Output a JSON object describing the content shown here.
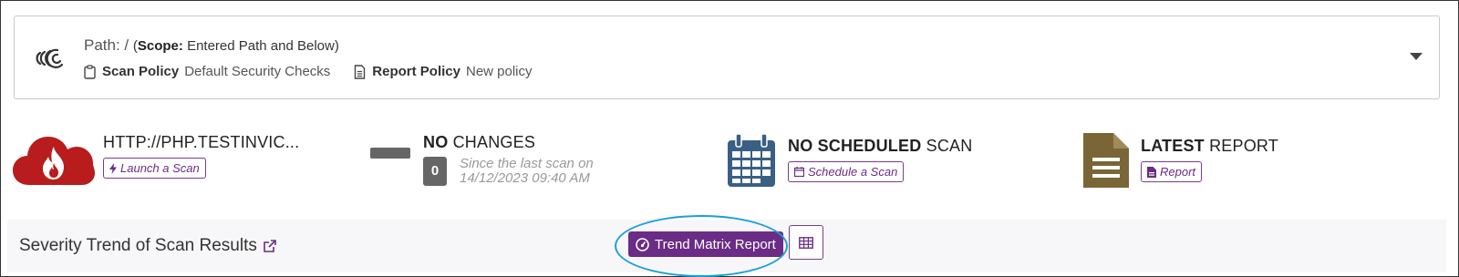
{
  "target": {
    "path_label": "Path: /",
    "scope_open": "(",
    "scope_label": "Scope:",
    "scope_value": "Entered Path and Below)",
    "scan_policy_label": "Scan Policy",
    "scan_policy_value": "Default Security Checks",
    "report_policy_label": "Report Policy",
    "report_policy_value": "New policy"
  },
  "stats": {
    "website": {
      "title": "HTTP://PHP.TESTINVIC...",
      "action": "Launch a Scan",
      "icon": "cloud-fire-icon",
      "color": "#b81c1c"
    },
    "changes": {
      "title_bold": "NO",
      "title_rest": "CHANGES",
      "count": "0",
      "since_line1": "Since the last scan on",
      "since_line2": "14/12/2023 09:40 AM"
    },
    "schedule": {
      "title_bold": "NO SCHEDULED",
      "title_rest": "SCAN",
      "action": "Schedule a Scan",
      "icon": "calendar-icon",
      "color": "#3a5f85"
    },
    "report": {
      "title_bold": "LATEST",
      "title_rest": "REPORT",
      "action": "Report",
      "icon": "document-icon",
      "color": "#7a6536"
    }
  },
  "trend": {
    "title": "Severity Trend of Scan Results",
    "matrix_button": "Trend Matrix Report",
    "accent": "#6a2c85",
    "highlight": "#1aa0d8"
  }
}
